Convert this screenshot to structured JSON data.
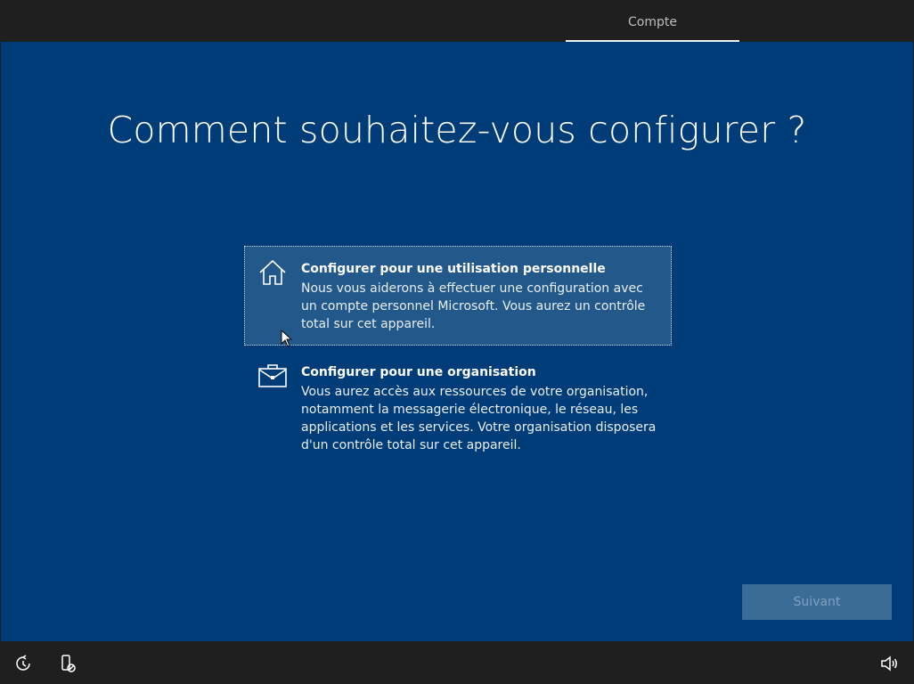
{
  "header": {
    "tab_label": "Compte"
  },
  "main": {
    "title": "Comment souhaitez-vous configurer ?",
    "options": [
      {
        "icon": "home-icon",
        "heading": "Configurer pour une utilisation personnelle",
        "description": "Nous vous aiderons à effectuer une configuration avec un compte personnel Microsoft. Vous aurez un contrôle total sur cet appareil.",
        "selected": true
      },
      {
        "icon": "briefcase-icon",
        "heading": "Configurer pour une organisation",
        "description": "Vous aurez accès aux ressources de votre organisation, notamment la messagerie électronique, le réseau, les applications et les services. Votre organisation disposera d'un contrôle total sur cet appareil.",
        "selected": false
      }
    ],
    "next_label": "Suivant"
  },
  "footer": {
    "icons": [
      "ease-of-access-icon",
      "device-icon",
      "volume-icon"
    ]
  },
  "colors": {
    "background": "#003d78",
    "bars": "#1f1f1f",
    "selected_option": "#23598a",
    "next_button": "#3b6c98"
  }
}
